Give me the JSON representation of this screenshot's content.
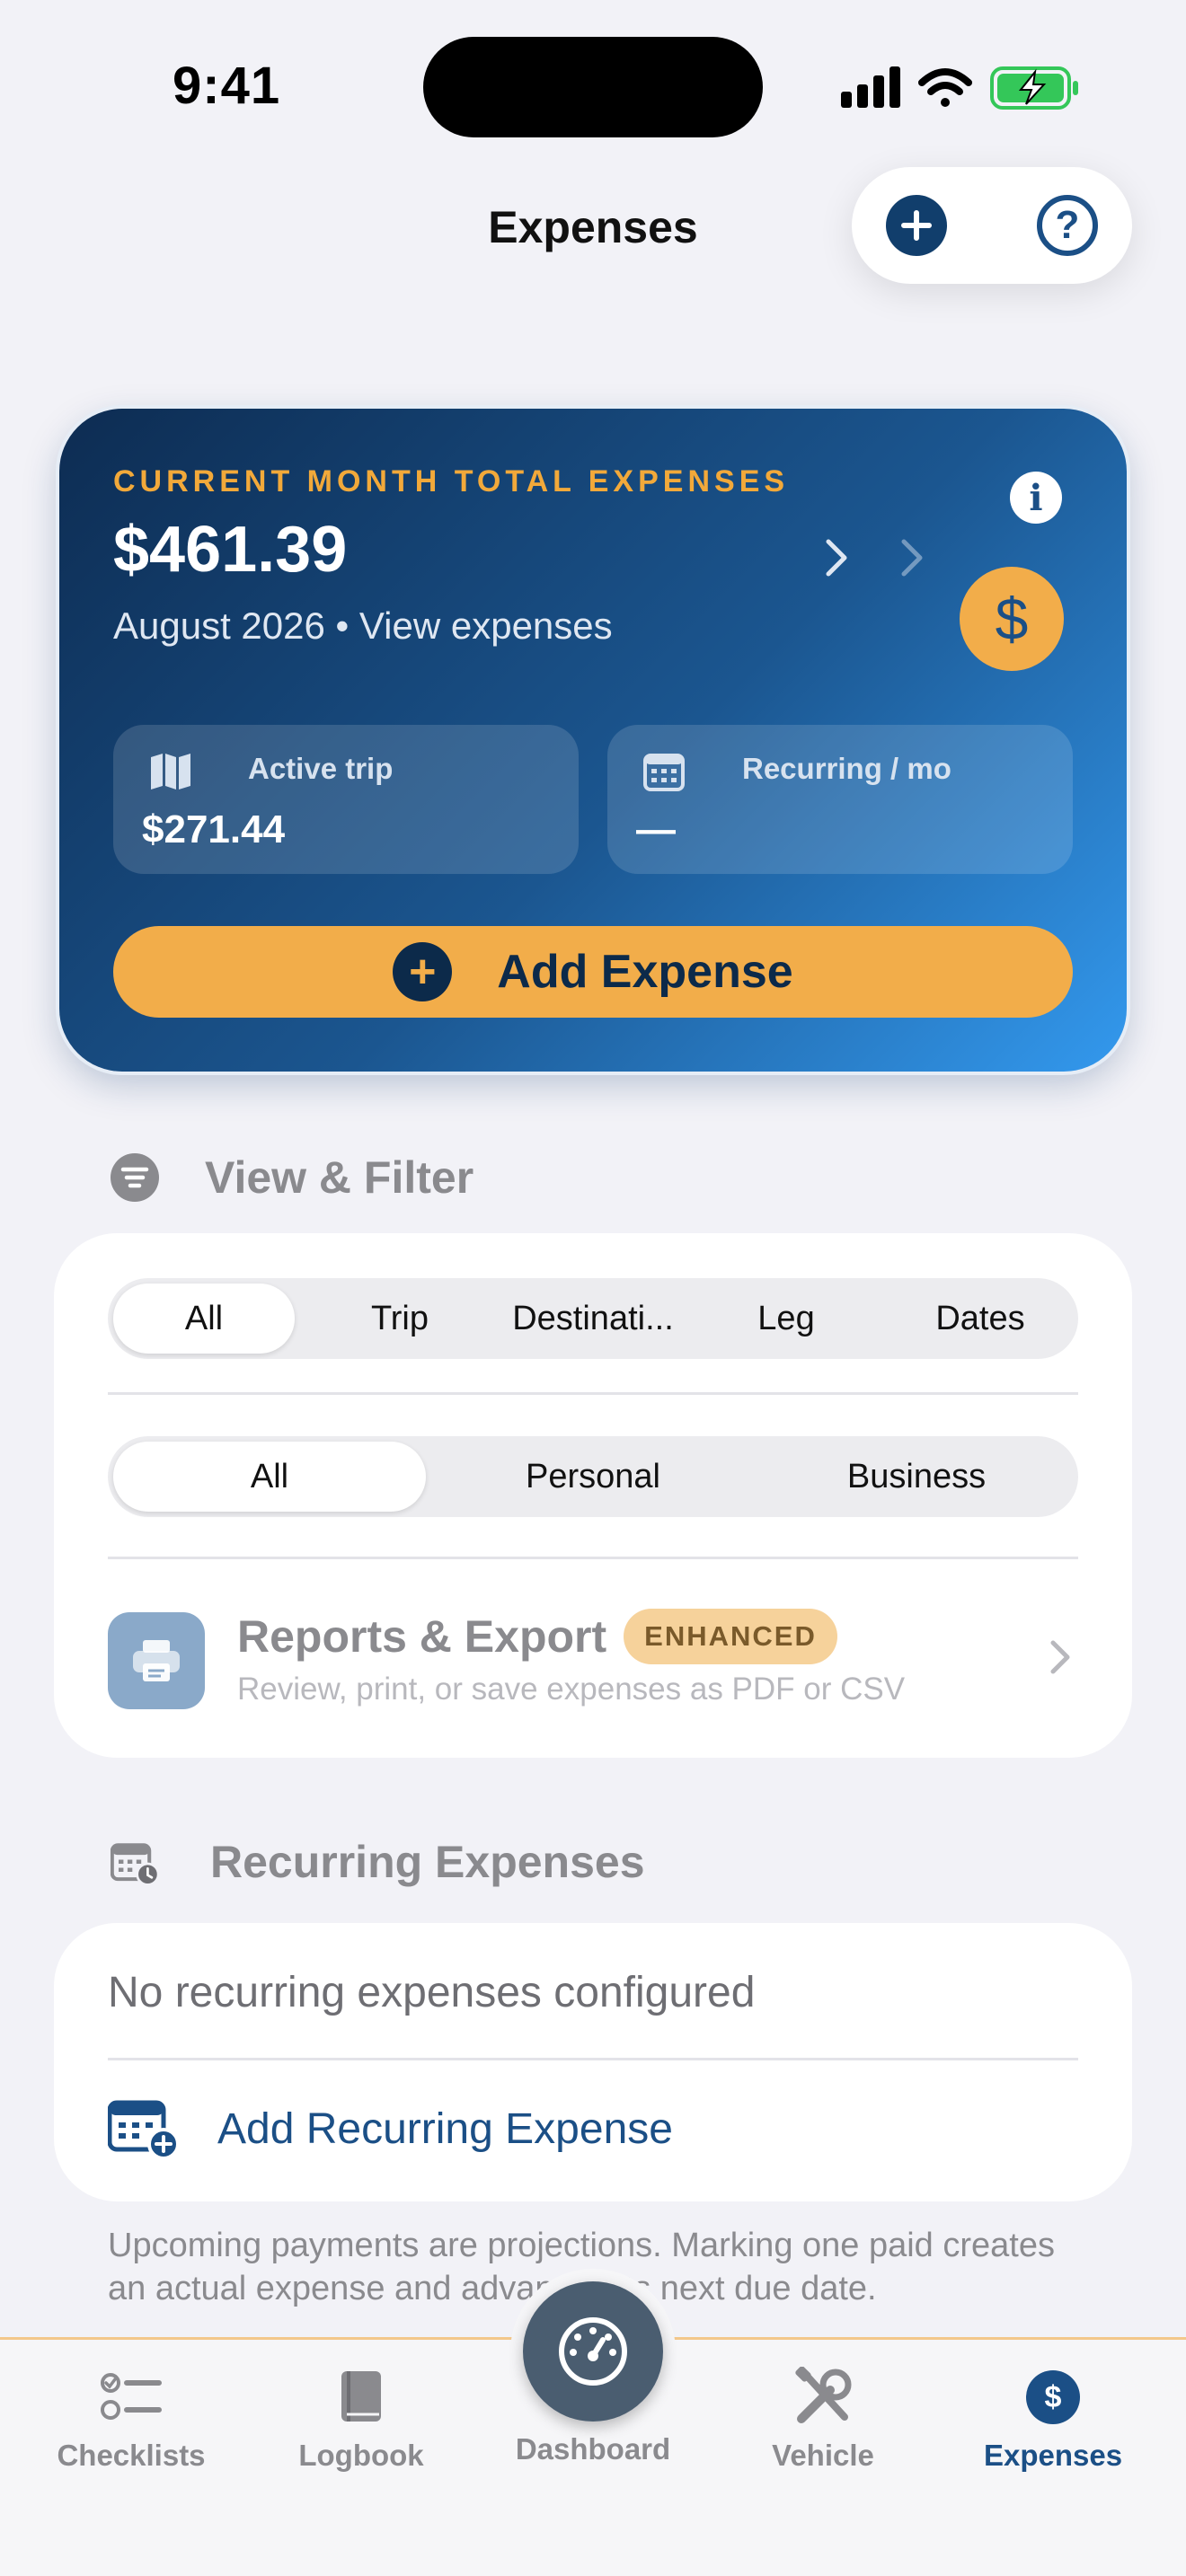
{
  "status_bar": {
    "time": "9:41"
  },
  "nav": {
    "title": "Expenses"
  },
  "hero": {
    "label": "CURRENT MONTH TOTAL EXPENSES",
    "amount": "$461.39",
    "subtitle": "August 2026 • View expenses",
    "coin_symbol": "$",
    "info_symbol": "i",
    "active_trip": {
      "label": "Active trip",
      "value": "$271.44"
    },
    "recurring": {
      "label": "Recurring / mo",
      "value": "—"
    },
    "add_button": {
      "label": "Add Expense",
      "icon": "+"
    }
  },
  "view_filter": {
    "title": "View & Filter",
    "scope_tabs": [
      "All",
      "Trip",
      "Destinati...",
      "Leg",
      "Dates"
    ],
    "scope_selected": "All",
    "type_tabs": [
      "All",
      "Personal",
      "Business"
    ],
    "type_selected": "All",
    "reports": {
      "title": "Reports & Export",
      "badge": "ENHANCED",
      "description": "Review, print, or save expenses as PDF or CSV"
    }
  },
  "recurring": {
    "title": "Recurring Expenses",
    "empty_text": "No recurring expenses configured",
    "add_label": "Add Recurring Expense",
    "footnote": "Upcoming payments are projections. Marking one paid creates an actual expense and advances its next due date."
  },
  "tabbar": {
    "items": [
      {
        "label": "Checklists",
        "icon": "checklist-icon",
        "active": false
      },
      {
        "label": "Logbook",
        "icon": "book-icon",
        "active": false
      },
      {
        "label": "Dashboard",
        "icon": "gauge-icon",
        "active": false
      },
      {
        "label": "Vehicle",
        "icon": "tools-icon",
        "active": false
      },
      {
        "label": "Expenses",
        "icon": "dollar-circle-icon",
        "active": true
      }
    ]
  },
  "colors": {
    "accent": "#1b4f86",
    "gold": "#f2ad4a",
    "hero_start": "#0d2c52",
    "hero_end": "#3399ee"
  }
}
